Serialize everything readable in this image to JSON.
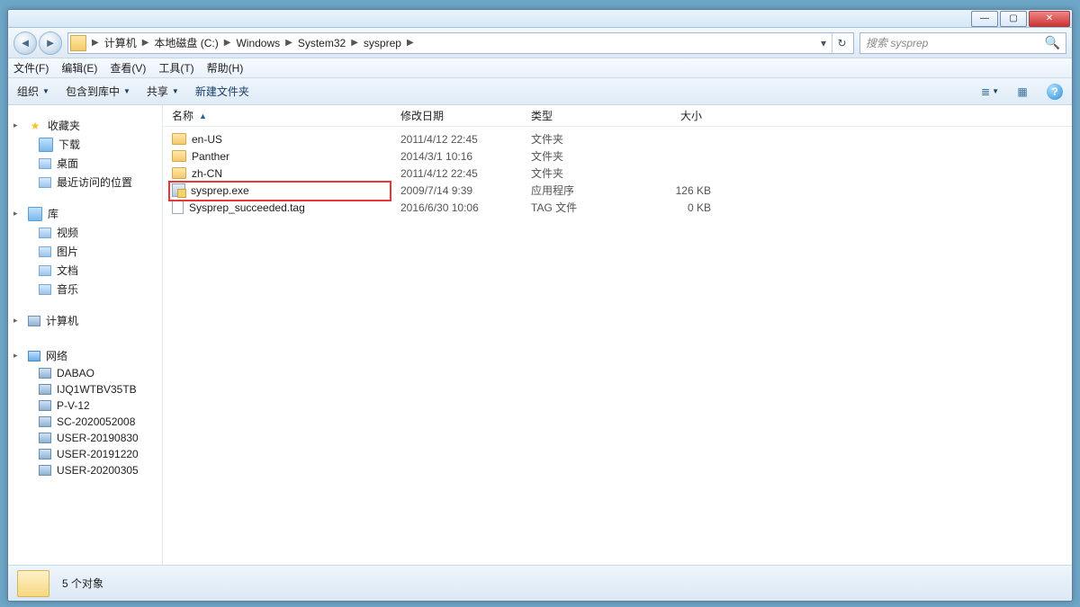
{
  "titlebar": {
    "min": "—",
    "max": "▢",
    "close": "✕"
  },
  "nav": {
    "back_glyph": "◄",
    "fwd_glyph": "►"
  },
  "breadcrumb": {
    "sep": "▶",
    "items": [
      "计算机",
      "本地磁盘 (C:)",
      "Windows",
      "System32",
      "sysprep"
    ],
    "refresh_glyph": "↻",
    "drop_glyph": "▾"
  },
  "search": {
    "placeholder": "搜索 sysprep",
    "icon": "🔍"
  },
  "menubar": {
    "file": "文件(F)",
    "edit": "编辑(E)",
    "view": "查看(V)",
    "tools": "工具(T)",
    "help": "帮助(H)"
  },
  "toolbar": {
    "organize": "组织",
    "include": "包含到库中",
    "share": "共享",
    "newfolder": "新建文件夹",
    "help_glyph": "?"
  },
  "sidebar": {
    "tri_open": "▸",
    "favorites": {
      "label": "收藏夹",
      "items": [
        "下载",
        "桌面",
        "最近访问的位置"
      ]
    },
    "libraries": {
      "label": "库",
      "items": [
        "视频",
        "图片",
        "文档",
        "音乐"
      ]
    },
    "computer": {
      "label": "计算机"
    },
    "network": {
      "label": "网络",
      "items": [
        "DABAO",
        "IJQ1WTBV35TB",
        "P-V-12",
        "SC-2020052008",
        "USER-20190830",
        "USER-20191220",
        "USER-20200305"
      ]
    }
  },
  "columns": {
    "name": "名称",
    "date": "修改日期",
    "type": "类型",
    "size": "大小",
    "sort_glyph": "▲"
  },
  "files": [
    {
      "name": "en-US",
      "date": "2011/4/12 22:45",
      "type": "文件夹",
      "size": "",
      "icon": "folder",
      "highlight": false
    },
    {
      "name": "Panther",
      "date": "2014/3/1 10:16",
      "type": "文件夹",
      "size": "",
      "icon": "folder",
      "highlight": false
    },
    {
      "name": "zh-CN",
      "date": "2011/4/12 22:45",
      "type": "文件夹",
      "size": "",
      "icon": "folder",
      "highlight": false
    },
    {
      "name": "sysprep.exe",
      "date": "2009/7/14 9:39",
      "type": "应用程序",
      "size": "126 KB",
      "icon": "exe",
      "highlight": true
    },
    {
      "name": "Sysprep_succeeded.tag",
      "date": "2016/6/30 10:06",
      "type": "TAG 文件",
      "size": "0 KB",
      "icon": "file",
      "highlight": false
    }
  ],
  "status": {
    "count_label": "5 个对象"
  }
}
